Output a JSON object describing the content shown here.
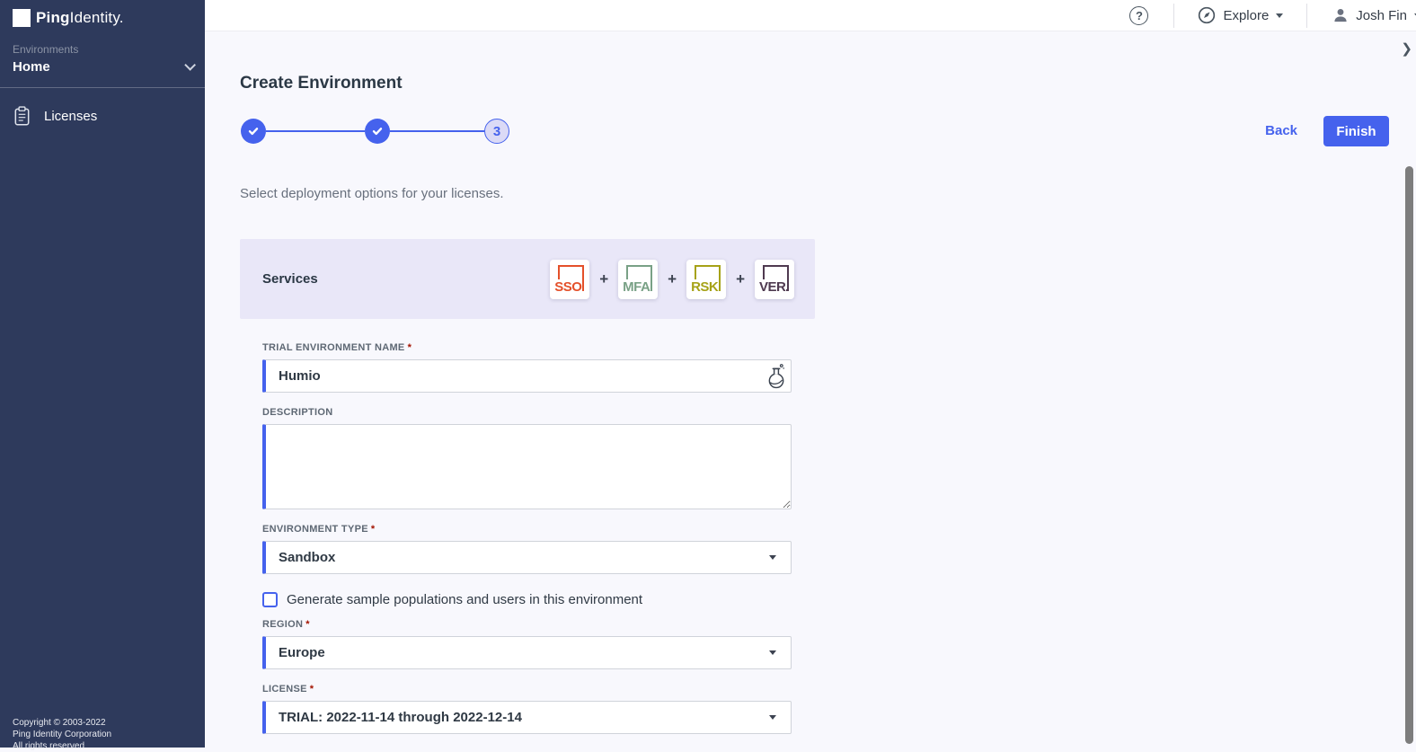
{
  "accent_color": "#4562ed",
  "sidebar": {
    "logo": {
      "brand_bold": "Ping",
      "brand_regular": "Identity."
    },
    "environments_label": "Environments",
    "current_environment": "Home",
    "nav": [
      {
        "label": "Licenses"
      }
    ],
    "copyright_lines": [
      "Copyright © 2003-2022",
      "Ping Identity Corporation",
      "All rights reserved"
    ]
  },
  "topbar": {
    "help_glyph": "?",
    "explore_label": "Explore",
    "user_name": "Josh Fin"
  },
  "page": {
    "title": "Create Environment",
    "subtitle": "Select deployment options for your licenses.",
    "back_label": "Back",
    "finish_label": "Finish",
    "collapse_glyph": "❯",
    "stepper": {
      "total_steps": 3,
      "completed_steps": 2,
      "current_step_label": "3"
    }
  },
  "services": {
    "title": "Services",
    "separator": "+",
    "items": [
      {
        "code": "SSO",
        "color": "#e4502a"
      },
      {
        "code": "MFA",
        "color": "#79a186"
      },
      {
        "code": "RSK",
        "color": "#a6a217"
      },
      {
        "code": "VER",
        "color": "#4f3a50"
      }
    ]
  },
  "form": {
    "required_marker": "*",
    "name_field": {
      "label": "TRIAL ENVIRONMENT NAME",
      "value": "Humio"
    },
    "description_field": {
      "label": "DESCRIPTION",
      "value": ""
    },
    "type_field": {
      "label": "ENVIRONMENT TYPE",
      "value": "Sandbox"
    },
    "sample_checkbox_label": "Generate sample populations and users in this environment",
    "region_field": {
      "label": "REGION",
      "value": "Europe"
    },
    "license_field": {
      "label": "LICENSE",
      "value": "TRIAL: 2022-11-14 through 2022-12-14"
    }
  }
}
